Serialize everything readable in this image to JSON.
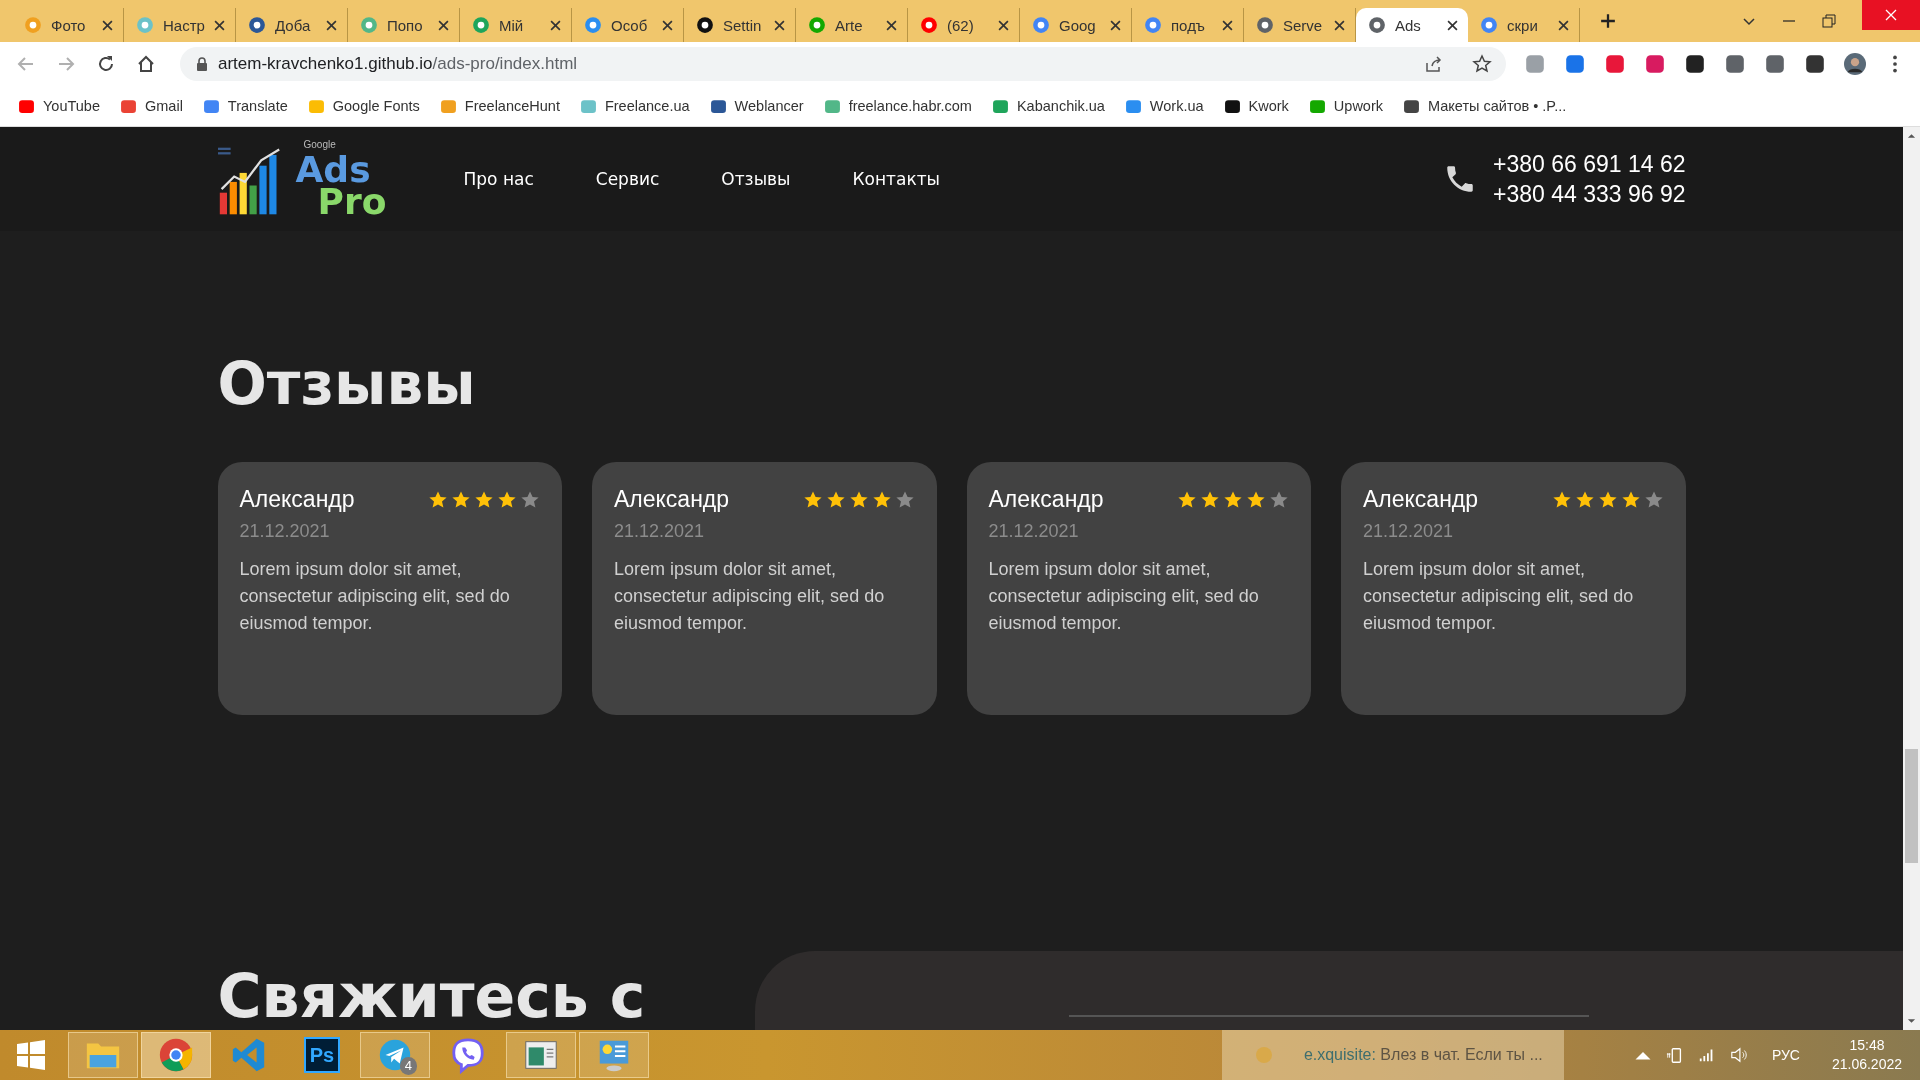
{
  "browser": {
    "tabs": [
      {
        "title": "Фото",
        "selected": false
      },
      {
        "title": "Настр",
        "selected": false
      },
      {
        "title": "Доба",
        "selected": false
      },
      {
        "title": "Попо",
        "selected": false
      },
      {
        "title": "Мій",
        "selected": false
      },
      {
        "title": "Особ",
        "selected": false
      },
      {
        "title": "Settin",
        "selected": false
      },
      {
        "title": "Arte",
        "selected": false
      },
      {
        "title": "(62)",
        "selected": false
      },
      {
        "title": "Goog",
        "selected": false
      },
      {
        "title": "подъ",
        "selected": false
      },
      {
        "title": "Serve",
        "selected": false
      },
      {
        "title": "Ads",
        "selected": true
      },
      {
        "title": "скри",
        "selected": false
      }
    ],
    "address": {
      "host": "artem-kravchenko1.github.io",
      "path": "/ads-pro/index.html"
    },
    "bookmarks": [
      "YouTube",
      "Gmail",
      "Translate",
      "Google Fonts",
      "FreelanceHunt",
      "Freelance.ua",
      "Weblancer",
      "freelance.habr.com",
      "Kabanchik.ua",
      "Work.ua",
      "Kwork",
      "Upwork",
      "Макеты сайтов • .P..."
    ]
  },
  "site": {
    "logo": {
      "small": "Google",
      "main": "Ads",
      "sub": "Pro"
    },
    "nav": [
      "Про нас",
      "Сервис",
      "Отзывы",
      "Контакты"
    ],
    "phones": [
      "+380 66 691 14 62",
      "+380 44 333 96 92"
    ],
    "reviews": {
      "heading": "Отзывы",
      "items": [
        {
          "name": "Александр",
          "date": "21.12.2021",
          "text": "Lorem ipsum dolor sit amet, consectetur adipiscing elit, sed do eiusmod tempor.",
          "stars": 4
        },
        {
          "name": "Александр",
          "date": "21.12.2021",
          "text": "Lorem ipsum dolor sit amet, consectetur adipiscing elit, sed do eiusmod tempor.",
          "stars": 4
        },
        {
          "name": "Александр",
          "date": "21.12.2021",
          "text": "Lorem ipsum dolor sit amet, consectetur adipiscing elit, sed do eiusmod tempor.",
          "stars": 4
        },
        {
          "name": "Александр",
          "date": "21.12.2021",
          "text": "Lorem ipsum dolor sit amet, consectetur adipiscing elit, sed do eiusmod tempor.",
          "stars": 4
        }
      ]
    },
    "contact": {
      "heading": "Свяжитесь с"
    }
  },
  "taskbar": {
    "apps": [
      {
        "kind": "explorer",
        "running": true,
        "selected": false
      },
      {
        "kind": "chrome",
        "running": true,
        "selected": true
      },
      {
        "kind": "vscode",
        "running": false,
        "selected": false
      },
      {
        "kind": "photoshop",
        "label": "Ps",
        "running": false,
        "selected": false
      },
      {
        "kind": "telegram",
        "badge": "4",
        "running": true,
        "selected": false
      },
      {
        "kind": "viber",
        "running": false,
        "selected": false
      },
      {
        "kind": "window",
        "running": true,
        "selected": false
      },
      {
        "kind": "panel",
        "running": true,
        "selected": false
      }
    ],
    "notification": {
      "sender": "e.xquisite:",
      "text": "Влез в чат. Если ты ..."
    },
    "language": "РУС",
    "time": "15:48",
    "date": "21.06.2022"
  }
}
